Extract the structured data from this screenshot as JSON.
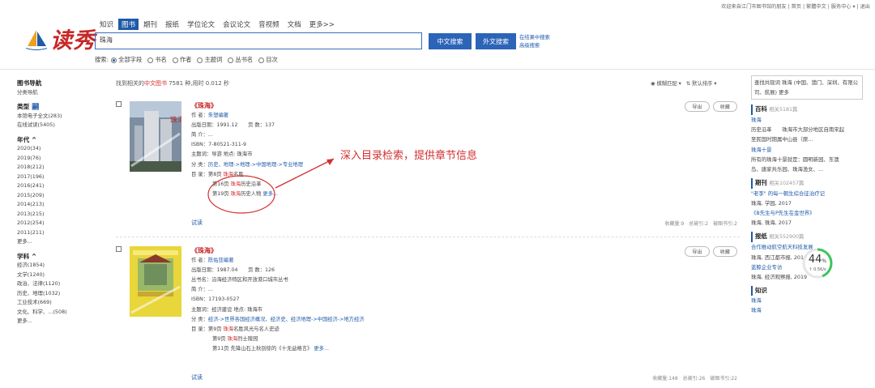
{
  "header": {
    "top_links": "欢迎来自江门市图书馆的朋友 | 首页 | 繁體中文 | 服务中心 ▾ | 退出",
    "logo_text": "读秀",
    "tabs": [
      {
        "label": "知识"
      },
      {
        "label": "图书"
      },
      {
        "label": "期刊"
      },
      {
        "label": "报纸"
      },
      {
        "label": "学位论文"
      },
      {
        "label": "会议论文"
      },
      {
        "label": "音视频"
      },
      {
        "label": "文档"
      },
      {
        "label": "更多>>"
      }
    ],
    "search_value": "珠海",
    "btn_cn": "中文搜索",
    "btn_foreign": "外文搜索",
    "in_results": "在结果中搜索",
    "advanced": "高级搜索",
    "scope_label": "搜索:",
    "scope_options": [
      "全部字段",
      "书名",
      "作者",
      "主题词",
      "丛书名",
      "目次"
    ]
  },
  "leftnav": {
    "title": "图书导航",
    "sub": "分类导航",
    "type_head": "类型",
    "type_items": [
      "本馆电子全文(283)",
      "在线试读(5405)"
    ],
    "year_head": "年代 ^",
    "years": [
      "2020(34)",
      "2019(76)",
      "2018(212)",
      "2017(196)",
      "2016(241)",
      "2015(209)",
      "2014(213)",
      "2013(215)",
      "2012(254)",
      "2011(211)"
    ],
    "more1": "更多...",
    "subj_head": "学科 ^",
    "subjects": [
      "经济(1854)",
      "文学(1240)",
      "政治、法律(1120)",
      "历史、地理(1032)",
      "工业技术(669)",
      "文化、科学、...(508)"
    ],
    "more2": "更多..."
  },
  "summary": {
    "pre": "找到相关的",
    "kind": "中文图书",
    "post": " 7581 种,用时 0.012 秒"
  },
  "sorts": {
    "fuzzy": "◉ 模糊匹配 ▾",
    "order": "⇅ 默认排序 ▾"
  },
  "books": [
    {
      "title": "《珠海》",
      "author_label": "作 者：",
      "author": "朱塑编著",
      "pub": "出版日期：1991.12　　页 数：137",
      "intro": "简 介：...",
      "isbn": "ISBN：7-80521-311-9",
      "subject": "主题词：导游 地点: 珠海市",
      "cat_label": "分 类：",
      "cat": "历史、地理->地理->中国地理->专业地理",
      "toc_label": "目 录：第8页 ",
      "toc_hl": "珠海",
      "toc_rest": "名胜",
      "toc2_pre": "第16页 ",
      "toc2_hl": "珠海",
      "toc2_rest": "历史沿革",
      "toc3_pre": "第19页 ",
      "toc3_hl": "珠海",
      "toc3_rest": "历史人物 ",
      "toc_more": "更多...",
      "trial": "试读",
      "export": "导出",
      "fav": "收藏",
      "stats": "收藏量:9　总被引:2　被图书引:2"
    },
    {
      "title": "《珠海》",
      "author_label": "作 者：",
      "author": "陈佑亚编著",
      "pub": "出版日期：1987.04　　页 数：126",
      "series": "丛书名：沿海经济特区和开放港口城市丛书",
      "intro": "简 介：...",
      "isbn": "ISBN：17193-0527",
      "subject": "主题词：经济建设 地点: 珠海市",
      "cat_label": "分 类：",
      "cat": "经济->世界各国经济概况、经济史、经济地理->中国经济->地方经济",
      "toc_label": "目 录：第9页 ",
      "toc_hl": "珠海",
      "toc_rest": "名胜风光与名人史迹",
      "toc2_pre": "第9页 ",
      "toc2_hl": "珠海",
      "toc2_rest": "烈士陵园",
      "toc3_pre": "第11页 先锋山石上秋别徐的《十无益格言》",
      "toc_more": "更多...",
      "trial": "试读",
      "export": "导出",
      "fav": "收藏",
      "stats": "收藏量:148　总被引:26　被图书引:22"
    }
  ],
  "callout": "深入目录检索，提供章节信息",
  "right": {
    "kbox": "查找共现词 珠海 (中国、澳门、深圳、有限公司、航展) 更多",
    "baike_head": "百科",
    "baike_cnt": "相关5181篇",
    "baike_items": [
      "珠海",
      "历史沿革　　珠海市大部分地区自南宋起",
      "至民国时期属中山县（原...",
      "珠海十景",
      "所有的珠海十景就是：圆明新园、东澳",
      "岛、唐家共乐园、珠海渔女、..."
    ],
    "qikan_head": "期刊",
    "qikan_cnt": "相关102457篇",
    "qikan_items": [
      "\"老李\" 的每一朝生综合征治疗记",
      "珠海, 学园, 2017",
      "《B先生与P先生在金世界》",
      "珠海, 珠海, 2017"
    ],
    "baozhi_head": "报纸",
    "baozhi_cnt": "相关552900篇",
    "baozhi_items": [
      "合作推动航空航天科技发展",
      "珠海, 西江都市报, 2018",
      "蓝鲸企业专访",
      "珠海, 经济观察报, 2019"
    ],
    "zhishi_head": "知识",
    "zhishi_items": [
      "珠海",
      "珠海"
    ]
  },
  "gauge": {
    "percent": 44,
    "unit": "%",
    "speed": "↑ 0.5K/s"
  }
}
